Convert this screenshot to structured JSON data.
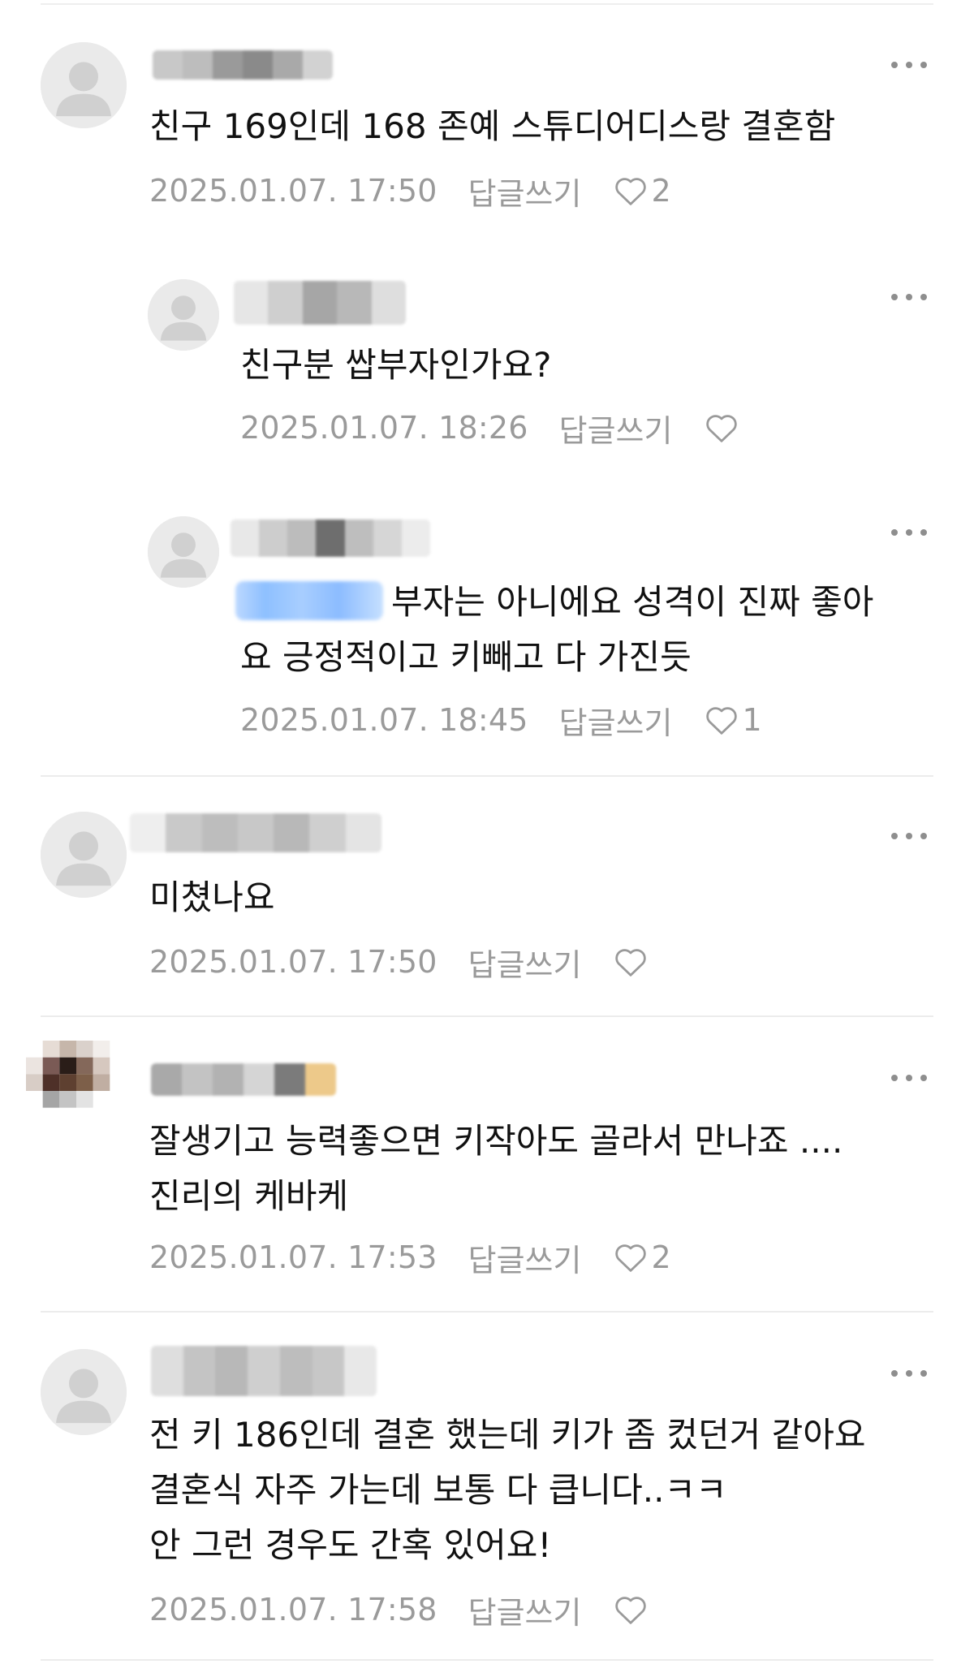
{
  "comments": [
    {
      "text": "친구 169인데 168 존예 스튜디어디스랑 결혼함",
      "date": "2025.01.07. 17:50",
      "reply_label": "답글쓰기",
      "likes": "2"
    },
    {
      "text": "친구분 쌉부자인가요?",
      "date": "2025.01.07. 18:26",
      "reply_label": "답글쓰기",
      "likes": ""
    },
    {
      "text_line1": "부자는 아니에요 성격이 진짜 좋아",
      "text_line2": "요 긍정적이고 키빼고 다 가진듯",
      "date": "2025.01.07. 18:45",
      "reply_label": "답글쓰기",
      "likes": "1"
    },
    {
      "text": "미쳤나요",
      "date": "2025.01.07. 17:50",
      "reply_label": "답글쓰기",
      "likes": ""
    },
    {
      "text_line1": "잘생기고 능력좋으면 키작아도 골라서 만나죠 ....",
      "text_line2": "진리의 케바케",
      "date": "2025.01.07. 17:53",
      "reply_label": "답글쓰기",
      "likes": "2"
    },
    {
      "text_line1": "전 키 186인데 결혼 했는데 키가 좀 컸던거 같아요",
      "text_line2": "결혼식 자주 가는데 보통 다 큽니다..ㅋㅋ",
      "text_line3": "안 그런 경우도 간혹 있어요!",
      "date": "2025.01.07. 17:58",
      "reply_label": "답글쓰기",
      "likes": ""
    }
  ],
  "icons": {
    "avatar": "default-profile-icon",
    "more": "more-dots-icon",
    "like": "heart-outline-icon"
  },
  "colors": {
    "text": "#111111",
    "meta": "#9a9a9a",
    "avatar_bg": "#eaeaea",
    "divider": "#ececec"
  }
}
